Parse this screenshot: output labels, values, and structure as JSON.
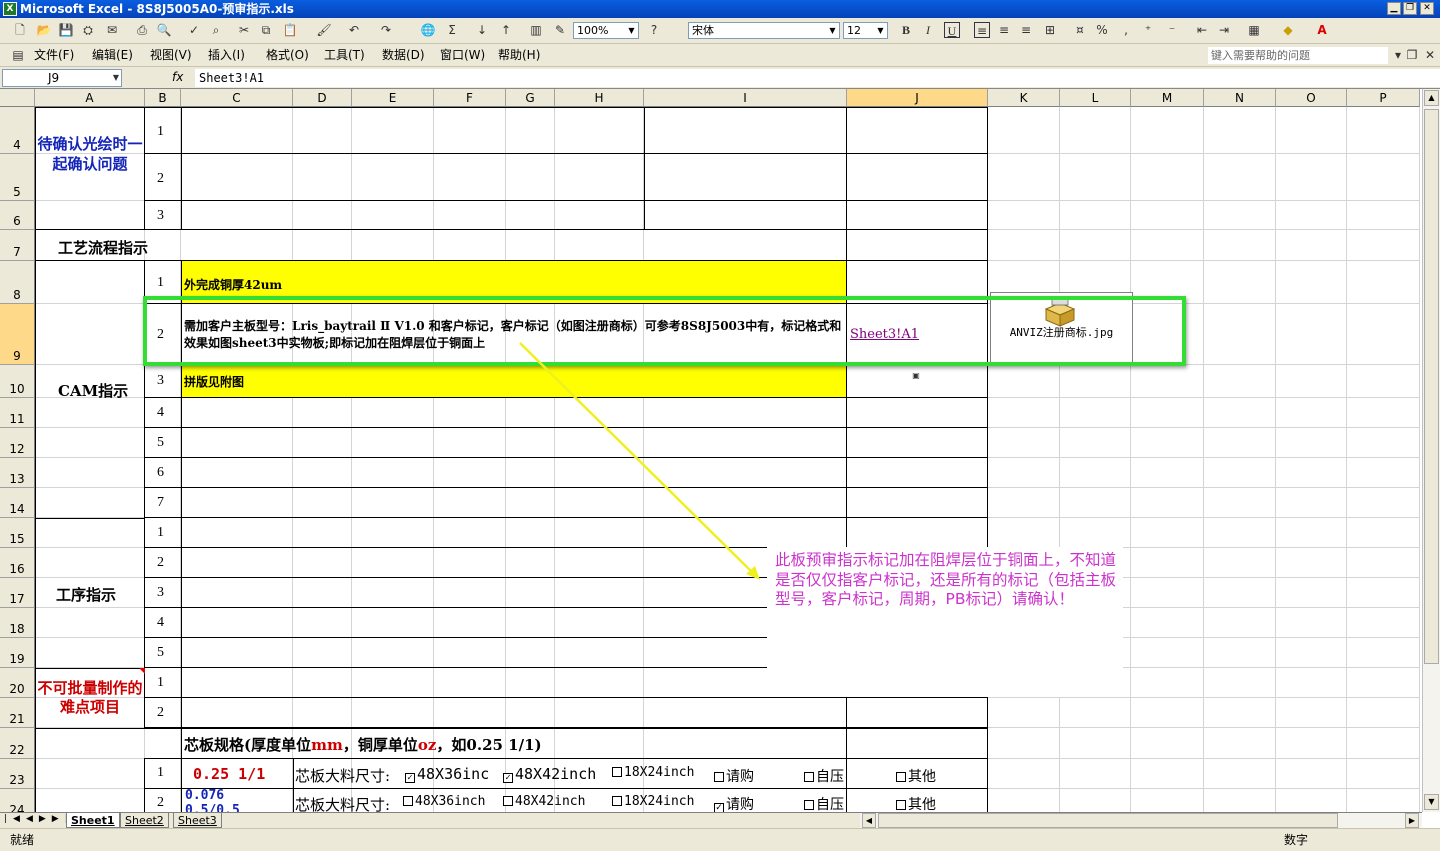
{
  "window": {
    "title": "Microsoft Excel - 8S8J5005A0-预审指示.xls",
    "app_icon": "X"
  },
  "toolbar": {
    "zoom": "100%",
    "font_name": "宋体",
    "font_size": "12"
  },
  "menu": [
    "文件(F)",
    "编辑(E)",
    "视图(V)",
    "插入(I)",
    "格式(O)",
    "工具(T)",
    "数据(D)",
    "窗口(W)",
    "帮助(H)"
  ],
  "help_placeholder": "键入需要帮助的问题",
  "formula_bar": {
    "name_box": "J9",
    "fx": "fx",
    "formula": "Sheet3!A1"
  },
  "columns": [
    "A",
    "B",
    "C",
    "D",
    "E",
    "F",
    "G",
    "H",
    "I",
    "J",
    "K",
    "L",
    "M",
    "N",
    "O",
    "P"
  ],
  "rows": [
    "4",
    "5",
    "6",
    "7",
    "8",
    "9",
    "10",
    "11",
    "12",
    "13",
    "14",
    "15",
    "16",
    "17",
    "18",
    "19",
    "20",
    "21",
    "22",
    "23",
    "24"
  ],
  "cells": {
    "a4": "待确认光绘时一起确认问题",
    "b4": "1",
    "b5": "2",
    "b6": "3",
    "a7": "工艺流程指示",
    "b8": "1",
    "c8": "外完成铜厚42um",
    "b9": "2",
    "c9": "需加客户主板型号：Lris_baytrail Ⅱ V1.0 和客户标记，客户标记（如图注册商标）可参考8S8J5003中有，标记格式和效果如图sheet3中实物板;即标记加在阻焊层位于铜面上",
    "j9": "Sheet3!A1",
    "b10": "3",
    "c10": "拼版见附图",
    "a10": "CAM指示",
    "b11": "4",
    "b12": "5",
    "b13": "6",
    "b14": "7",
    "a15": "工序指示",
    "b15": "1",
    "b16": "2",
    "b17": "3",
    "b18": "4",
    "b19": "5",
    "a20": "不可批量制作的难点项目",
    "b20": "1",
    "b21": "2",
    "c22_a": "芯板规格(厚度单位",
    "c22_b": "mm",
    "c22_c": "，铜厚单位",
    "c22_d": "oz",
    "c22_e": "，如0.25 1/1)",
    "b23": "1",
    "c23": "0.25   1/1",
    "b24": "2",
    "c24": "0.076",
    "c24b": "0.5/0.5",
    "core_size_label": "芯板大料尺寸:",
    "opt_48x36": "48X36inc",
    "opt_48x42": "48X42inch",
    "opt_18x24": "18X24inch",
    "opt_buy": "请购",
    "opt_self": "自压",
    "opt_other": "其他",
    "opt_48x36_r24": "48X36inch"
  },
  "anviz_object": "ANVIZ注册商标.jpg",
  "comment": "此板预审指示标记加在阻焊层位于铜面上，不知道是否仅仅指客户标记，还是所有的标记（包括主板型号，客户标记，周期，PB标记）请确认！",
  "sheets": [
    "Sheet1",
    "Sheet2",
    "Sheet3"
  ],
  "status": {
    "left": "就绪",
    "right": "数字"
  },
  "colors": {
    "highlight_yellow": "#ffff00",
    "green_box": "#33dd33",
    "comment_text": "#cc33cc",
    "blue_header": "#1525b8",
    "red_header": "#cc0000"
  }
}
